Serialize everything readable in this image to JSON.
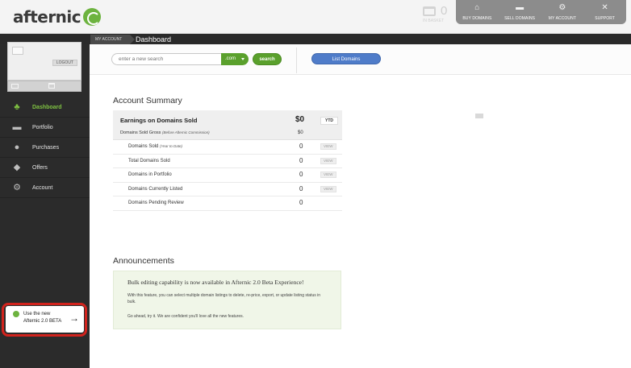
{
  "brand": {
    "name": "afternic",
    "accent": "#6db33f"
  },
  "header": {
    "basket": {
      "count": "0",
      "label": "IN BASKET",
      "icon": "basket-icon"
    },
    "nav": [
      {
        "label": "BUY DOMAINS",
        "icon": "store-icon"
      },
      {
        "label": "SELL DOMAINS",
        "icon": "folder-icon"
      },
      {
        "label": "MY ACCOUNT",
        "icon": "gears-icon"
      },
      {
        "label": "SUPPORT",
        "icon": "wrench-icon"
      }
    ]
  },
  "breadcrumb": {
    "section": "MY ACCOUNT",
    "page": "Dashboard"
  },
  "account_card": {
    "logout_label": "LOGOUT"
  },
  "sidebar": {
    "items": [
      {
        "label": "Dashboard",
        "icon": "tree-icon",
        "active": true
      },
      {
        "label": "Portfolio",
        "icon": "card-icon",
        "active": false
      },
      {
        "label": "Purchases",
        "icon": "egg-icon",
        "active": false
      },
      {
        "label": "Offers",
        "icon": "tag-icon",
        "active": false
      },
      {
        "label": "Account",
        "icon": "gears-icon",
        "active": false
      }
    ],
    "beta": {
      "line1": "Use the new",
      "line2": "Afternic 2.0 BETA",
      "arrow": "→"
    }
  },
  "search": {
    "placeholder": "enter a new search",
    "tld": ".com",
    "button_label": "search",
    "list_domains_label": "List Domains"
  },
  "summary": {
    "title": "Account Summary",
    "earnings_label": "Earnings on Domains Sold",
    "earnings_value": "$0",
    "ytd_label": "YTD",
    "gross_label": "Domains Sold Gross",
    "gross_note": "(Before Afternic Commission)",
    "gross_value": "$0",
    "view_label": "VIEW",
    "rows": [
      {
        "label": "Domains Sold",
        "note": "(Year to Date)",
        "value": "0",
        "has_view": true
      },
      {
        "label": "Total Domains Sold",
        "note": "",
        "value": "0",
        "has_view": true
      },
      {
        "label": "Domains in Portfolio",
        "note": "",
        "value": "0",
        "has_view": true
      },
      {
        "label": "Domains Currently Listed",
        "note": "",
        "value": "0",
        "has_view": true
      },
      {
        "label": "Domains Pending Review",
        "note": "",
        "value": "0",
        "has_view": false
      }
    ]
  },
  "announcements": {
    "title": "Announcements",
    "heading": "Bulk editing capability is now available in Afternic 2.0 Beta Experience!",
    "body": "With this feature, you can select multiple domain listings to delete, re-price, export, or update listing status in bulk.",
    "cta": "Go ahead, try it. We are confident you'll love all the new features."
  }
}
